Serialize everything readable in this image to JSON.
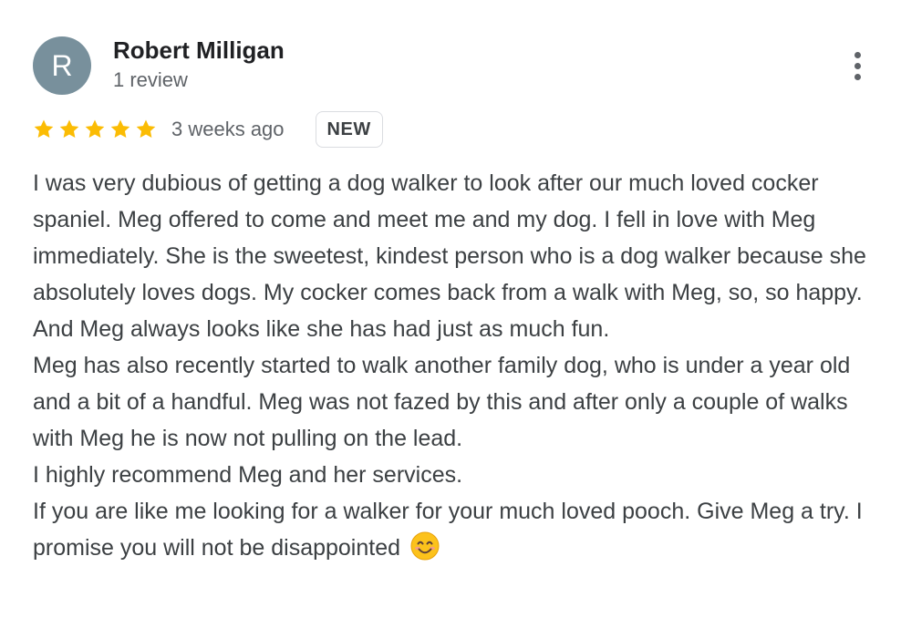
{
  "review": {
    "author": {
      "initial": "R",
      "name": "Robert Milligan",
      "review_count": "1 review",
      "avatar_color": "#78909c"
    },
    "rating": 5,
    "star_color": "#fbbc04",
    "timestamp": "3 weeks ago",
    "badge": "NEW",
    "paragraphs": [
      "I was very dubious of getting a dog walker to look after our much loved cocker spaniel. Meg offered to come and meet me and my dog. I fell in love with Meg immediately. She is the sweetest, kindest person who is a dog walker because she absolutely loves dogs. My cocker comes back from a walk with Meg, so, so happy. And Meg always looks like she has had just as much fun.",
      "Meg has also recently started to walk another family dog, who is under a year old and a bit of a handful. Meg was not fazed by this and after only a couple of walks with Meg he is now not pulling on the lead.",
      "I highly recommend Meg and her services.",
      "If you are like me looking for a walker for your much loved pooch. Give Meg a try. I promise you will not be disappointed"
    ],
    "trailing_emoji": "smiling-face-with-smiling-eyes",
    "menu_icon": "more-vert-icon"
  }
}
